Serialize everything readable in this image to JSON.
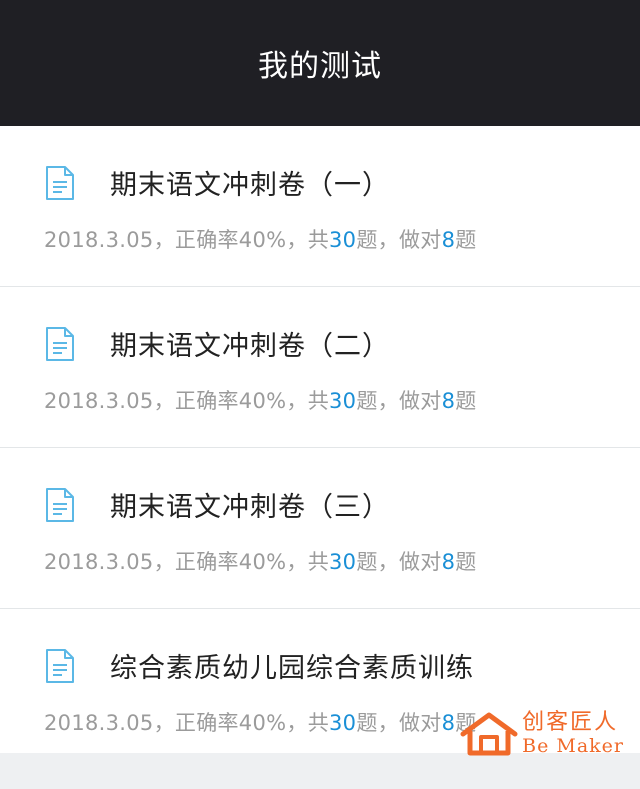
{
  "header": {
    "title": "我的测试"
  },
  "items": [
    {
      "title": "期末语文冲刺卷（一）",
      "date": "2018.3.05",
      "sep1": "，",
      "accuracy_label": "正确率40%",
      "sep2": "，",
      "total_prefix": "共",
      "total": "30",
      "total_suffix": "题",
      "sep3": "，",
      "correct_prefix": "做对",
      "correct": "8",
      "correct_suffix": "题"
    },
    {
      "title": "期末语文冲刺卷（二）",
      "date": "2018.3.05",
      "sep1": "，",
      "accuracy_label": "正确率40%",
      "sep2": "，",
      "total_prefix": "共",
      "total": "30",
      "total_suffix": "题",
      "sep3": "，",
      "correct_prefix": "做对",
      "correct": "8",
      "correct_suffix": "题"
    },
    {
      "title": "期末语文冲刺卷（三）",
      "date": "2018.3.05",
      "sep1": "，",
      "accuracy_label": "正确率40%",
      "sep2": "，",
      "total_prefix": "共",
      "total": "30",
      "total_suffix": "题",
      "sep3": "，",
      "correct_prefix": "做对",
      "correct": "8",
      "correct_suffix": "题"
    },
    {
      "title": "综合素质幼儿园综合素质训练",
      "date": "2018.3.05",
      "sep1": "，",
      "accuracy_label": "正确率40%",
      "sep2": "，",
      "total_prefix": "共",
      "total": "30",
      "total_suffix": "题",
      "sep3": "，",
      "correct_prefix": "做对",
      "correct": "8",
      "correct_suffix": "题"
    }
  ],
  "watermark": {
    "cn": "创客匠人",
    "en": "Be Maker"
  },
  "colors": {
    "header_bg": "#1f1f24",
    "accent_blue": "#1a8fd6",
    "icon_blue": "#5bb8e6",
    "watermark_orange": "#f06a2a"
  },
  "icons": {
    "item": "document-icon",
    "watermark": "house-logo-icon"
  }
}
